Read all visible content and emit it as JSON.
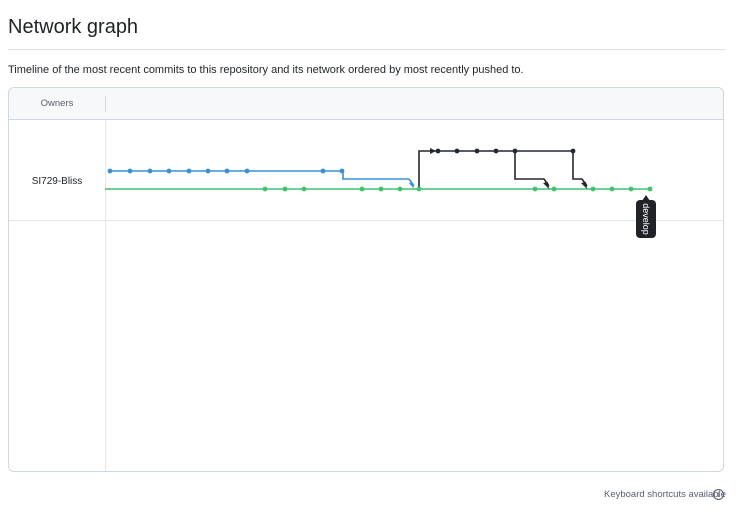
{
  "page": {
    "title": "Network graph",
    "description": "Timeline of the most recent commits to this repository and its network ordered by most recently pushed to."
  },
  "graph": {
    "owners_header": "Owners",
    "owner": "SI729-Bliss",
    "branch_label": "develop",
    "colors": {
      "blue": "#3a8fd6",
      "green": "#3fc46b",
      "black": "#24292f"
    }
  },
  "footer": {
    "keyboard_hint": "Keyboard shortcuts available",
    "info_icon": "i"
  }
}
